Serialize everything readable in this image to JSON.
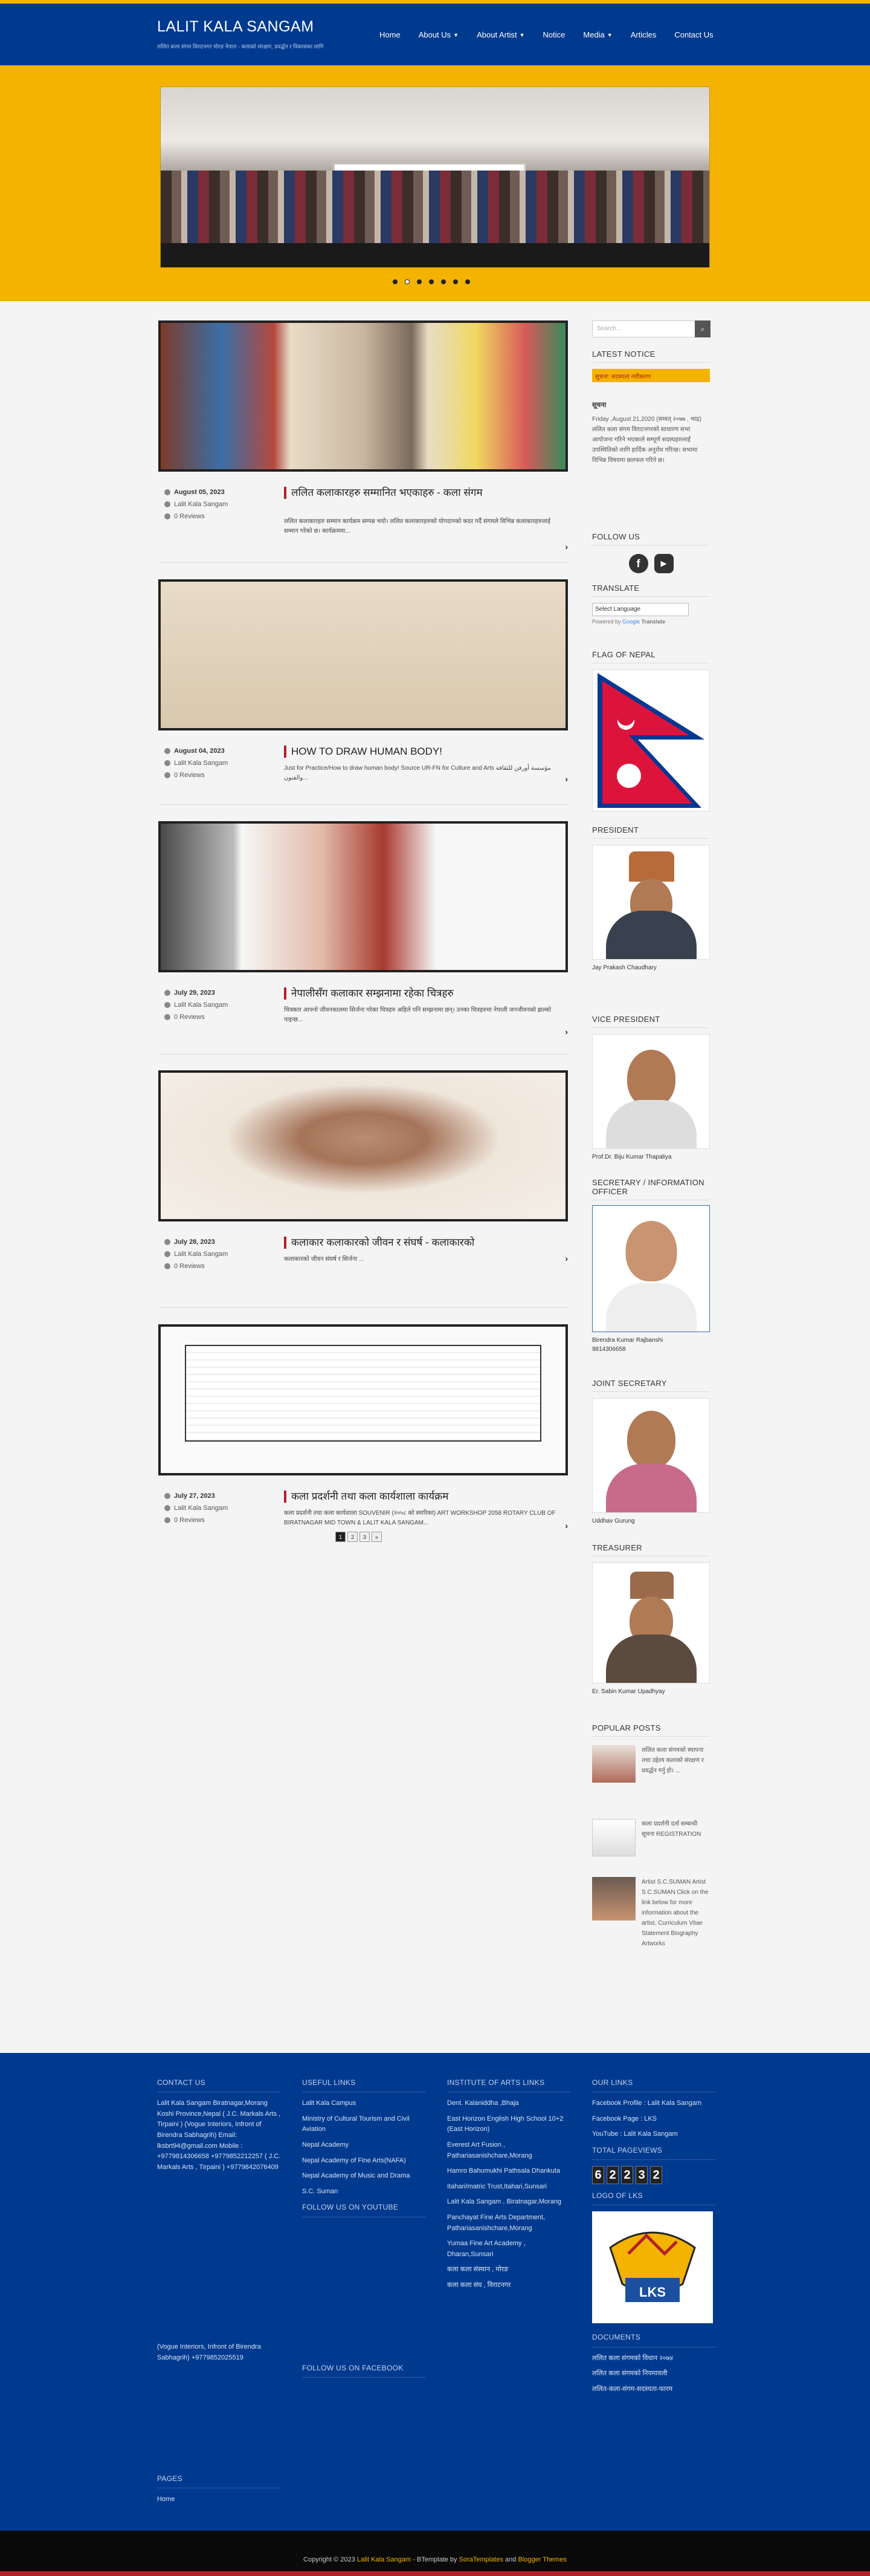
{
  "site": {
    "title": "LALIT KALA SANGAM",
    "description": "ललित कला संगम विराटनगर मोरङ नेपाल - कलाको संरक्षण, प्रवर्द्धन र विकासका लागि"
  },
  "nav": [
    {
      "label": "Home"
    },
    {
      "label": "About Us",
      "dropdown": true
    },
    {
      "label": "About Artist",
      "dropdown": true
    },
    {
      "label": "Notice"
    },
    {
      "label": "Media",
      "dropdown": true
    },
    {
      "label": "Articles"
    },
    {
      "label": "Contact Us"
    }
  ],
  "slider": {
    "slides": 7,
    "active": 1
  },
  "posts": [
    {
      "date": "August 05, 2023",
      "author": "Lalit Kala Sangam",
      "reviews": "0 Reviews",
      "title": "ललित कलाकारहरु सम्मानित भएकाहरु - कला संगम",
      "excerpt": "ललित कलाकारहरु सम्मान कार्यक्रम सम्पन्न भयो। ललित कलाकारहरुको योगदानको कदर गर्दै संगमले विभिन्न कलाकारहरुलाई सम्मान गरेको छ। कार्यक्रममा..."
    },
    {
      "date": "August 04, 2023",
      "author": "Lalit Kala Sangam",
      "reviews": "0 Reviews",
      "title": "HOW TO DRAW HUMAN BODY!",
      "excerpt": "Just for Practice/How to draw human body! Source UR-FN for Culture and Arts مؤسسة أورفن للثقافة والفنون..."
    },
    {
      "date": "July 29, 2023",
      "author": "Lalit Kala Sangam",
      "reviews": "0 Reviews",
      "title": "नेपालीसँग कलाकार सम्झनामा रहेका चित्रहरु",
      "excerpt": "चित्रकार आफ्नो जीवनकालमा सिर्जना गरेका चित्रहरु अहिले पनि सम्झनामा छन्। उनका चित्रहरुमा नेपाली जनजीवनको झल्को पाइन्छ..."
    },
    {
      "date": "July 28, 2023",
      "author": "Lalit Kala Sangam",
      "reviews": "0 Reviews",
      "title": "कलाकार कलाकारको जीवन र संघर्ष - कलाकारको",
      "excerpt": "कलाकारको जीवन संघर्ष र सिर्जना ..."
    },
    {
      "date": "July 27, 2023",
      "author": "Lalit Kala Sangam",
      "reviews": "0 Reviews",
      "title": "कला प्रदर्शनी तथा कला कार्यशाला कार्यक्रम",
      "excerpt": "कला प्रदर्शनी तथा कला कार्यशाला SOUVENIR (२०५८ को स्मारिका) ART WORKSHOP 2058 ROTARY CLUB OF BIRATNAGAR MID TOWN & LALIT KALA SANGAM..."
    }
  ],
  "pager": [
    "1",
    "2",
    "3",
    "»"
  ],
  "sidebar": {
    "search_placeholder": "Search...",
    "latest_notice_title": "LATEST NOTICE",
    "notice_ticker": "सूचना: सदस्यता नवीकरण",
    "notice_heading": "सूचना",
    "notice_body": "Friday ,August 21,2020 (सम्वत् २०७७ , भाद्र) ललित कला संगम विराटनगरको साधारण सभा आयोजना गरिने भएकाले सम्पूर्ण सदस्यहरुलाई उपस्थितिको लागि हार्दिक अनुरोध गरिन्छ। सभामा विभिन्न विषयमा छलफल गरिने छ।",
    "follow_title": "FOLLOW US",
    "translate_title": "TRANSLATE",
    "translate_select": "Select Language",
    "translate_powered": "Powered by",
    "translate_brand": "Translate",
    "flag_title": "FLAG OF NEPAL",
    "president_title": "PRESIDENT",
    "president_name": "Jay Prakash Chaudhary",
    "vp_title": "VICE PRESIDENT",
    "vp_name": "Prof.Dr. Biju Kumar Thapaliya",
    "secretary_title": "SECRETARY / INFORMATION OFFICER",
    "secretary_name": "Birendra Kumar Rajbanshi",
    "secretary_phone": "9814306658",
    "joint_title": "JOINT SECRETARY",
    "joint_name": "Uddhav Gurung",
    "treasurer_title": "TREASURER",
    "treasurer_name": "Er. Sabin Kumar Upadhyay",
    "popular_title": "POPULAR POSTS",
    "popular": [
      "ललित कला संगमको स्थापना तथा उद्देश्य कलाको संरक्षण र प्रवर्द्धन गर्नु हो। ...",
      "कला प्रदर्शनी दर्ता सम्बन्धी सूचना REGISTRATION",
      "Artist S.C.SUMAN Artist S.C.SUMAN Click on the link below for more information about the artist. Curriculum Vitae Statement Biography Artworks"
    ]
  },
  "footer": {
    "contact_title": "CONTACT US",
    "contact_text": "Lalit Kala Sangam Biratnagar,Morang Koshi Province,Nepal ( J.C. Markals Arts , Tirpaini ) (Vogue Interiors, Infront of Birendra Sabhagrih) Email: lksbrt94@gmail.com Mobile : +9779814306658 +9779852212257 ( J.C. Markals Arts , Tirpaini ) +9779842076409",
    "contact_text2": "(Vogue Interiors, Infront of Birendra Sabhagrih) +9779852025519",
    "useful_title": "USEFUL LINKS",
    "useful": [
      "Lalit Kala Campus",
      "Ministry of Cultural Tourism and Civil Aviation",
      "Nepal Academy",
      "Nepal Academy of Fine Arts(NAFA)",
      "Nepal Academy of Music and Drama",
      "S.C. Suman"
    ],
    "youtube_title": "FOLLOW US ON YOUTUBE",
    "facebook_title": "FOLLOW US ON FACEBOOK",
    "inst_title": "INSTITUTE OF ARTS LINKS",
    "inst": [
      "Dent. Kalaniddha ,Bhaja",
      "East Horizon English High School 10+2 (East Horizon)",
      "Everest Art Fusion , Pathariasanishchare,Morang",
      "Hamro Bahumukhi Pathsala Dhankuta",
      "Itahari/matric Trust,Itahari,Sunsari",
      "Lalit Kala Sangam , Biratnagar,Morang",
      "Panchayat Fine Arts Department, Pathariasanishchare,Morang",
      "Yumaa Fine Art Academy , Dharan,Sunsari",
      "कला कला संस्थान , मोरङ",
      "कला कला संघ , विराटनगर"
    ],
    "ourlinks_title": "OUR LINKS",
    "ourlinks": [
      "Facebook Profile : Lalit Kala Sangam",
      "Facebook Page : LKS",
      "YouTube : Lalit Kala Sangam"
    ],
    "pageviews_title": "TOTAL PAGEVIEWS",
    "pageviews": [
      "6",
      "2",
      "2",
      "3",
      "2"
    ],
    "logo_title": "LOGO OF LKS",
    "logo_text": "LKS",
    "docs_title": "DOCUMENTS",
    "docs": [
      "ललित कला संगमको विधान २०७४",
      "ललित कला संगमको नियमावली",
      "ललित-कला-संगम-सदस्यता-फारम"
    ],
    "pages_title": "PAGES",
    "pages": [
      "Home"
    ]
  },
  "copyright": {
    "prefix": "Copyright © 2023",
    "site": "Lalit Kala Sangam",
    "mid": " - BTemplate by ",
    "a1": "SoraTemplates",
    "and": " and ",
    "a2": "Blogger Themes"
  },
  "colors": {
    "brand_blue": "#003a8f",
    "brand_yellow": "#f3b300",
    "accent_red": "#b3202a"
  }
}
